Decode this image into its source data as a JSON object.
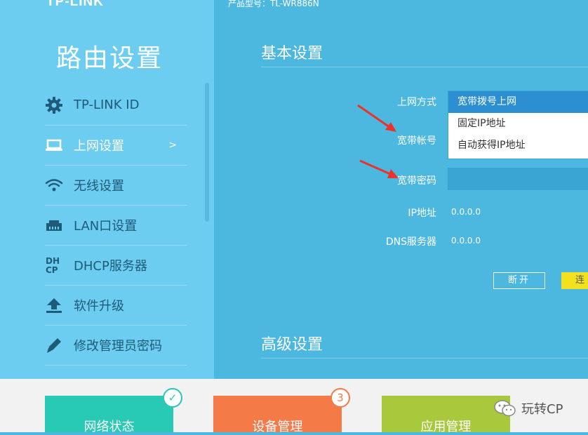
{
  "sidebar": {
    "logo": "TP-LINK",
    "title": "路由设置",
    "items": [
      {
        "label": "TP-LINK ID",
        "icon": "gear-icon"
      },
      {
        "label": "上网设置",
        "icon": "laptop-icon",
        "arrow": ">"
      },
      {
        "label": "无线设置",
        "icon": "wifi-icon"
      },
      {
        "label": "LAN口设置",
        "icon": "lan-port-icon"
      },
      {
        "label": "DHCP服务器",
        "icon": "dhcp-icon"
      },
      {
        "label": "软件升级",
        "icon": "upload-icon"
      },
      {
        "label": "修改管理员密码",
        "icon": "pencil-icon"
      }
    ]
  },
  "header": {
    "model": "产品型号：TL-WR886N"
  },
  "main": {
    "basic_title": "基本设置",
    "fields": {
      "mode_label": "上网方式",
      "account_label": "宽带帐号",
      "password_label": "宽带密码",
      "ip_label": "IP地址",
      "ip_value": "0.0.0.0",
      "dns_label": "DNS服务器",
      "dns_value": "0.0.0.0"
    },
    "dropdown_options": [
      "宽带拨号上网",
      "固定IP地址",
      "自动获得IP地址"
    ],
    "disconnect_label": "断开",
    "connect_label": "连",
    "advanced_title": "高级设置"
  },
  "bottom": {
    "tiles": [
      {
        "label": "网络状态",
        "color": "#28c9b5",
        "badge": "✓"
      },
      {
        "label": "设备管理",
        "color": "#f47a48",
        "badge": "3"
      },
      {
        "label": "应用管理",
        "color": "#a8c93c"
      }
    ]
  },
  "watermark": "玩转CP",
  "colors": {
    "accent": "#4cb8e0",
    "sidebar": "#6dcdf0",
    "selected": "#2b8fd1",
    "annotation": "#e8342a"
  }
}
